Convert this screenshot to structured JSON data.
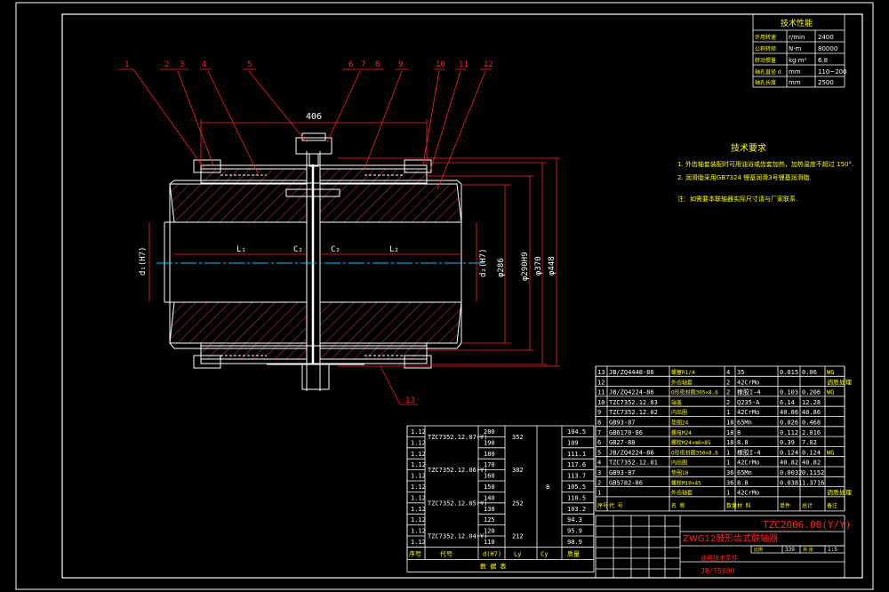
{
  "colors": {
    "background": "#000000",
    "frame": "#ffffff",
    "part": "#ffffff",
    "leader": "#ff2020",
    "centerline": "#00c8ff",
    "note": "#ffff00",
    "hatch": "#b5304a",
    "table": "#ffffff"
  },
  "balloons": [
    "1",
    "2",
    "3",
    "4",
    "5",
    "6",
    "7",
    "8",
    "9",
    "10",
    "11",
    "12",
    "13"
  ],
  "dimensions": {
    "overall_length": "406",
    "left_hub_len": "L₁",
    "left_gap": "C₂",
    "right_gap": "C₂",
    "right_hub_len": "L₂",
    "bore_left": "d₁(H7)",
    "bore_right": "d₂(H7)",
    "dia_286": "φ286",
    "dia_290": "φ290H9",
    "dia_370": "φ370",
    "dia_448": "φ448"
  },
  "tech_perf": {
    "title": "技术性能",
    "rows": [
      {
        "name": "许用转速",
        "unit": "r/min",
        "value": "2400"
      },
      {
        "name": "公称转矩",
        "unit": "N·m",
        "value": "80000"
      },
      {
        "name": "转动惯量",
        "unit": "kg·m²",
        "value": "6.8"
      },
      {
        "name": "轴孔直径 d",
        "unit": "mm",
        "value": "110~200"
      },
      {
        "name": "轴孔长度",
        "unit": "mm",
        "value": "2500"
      }
    ]
  },
  "tech_req": {
    "title": "技术要求",
    "items": [
      "1. 外齿轴套装配时可用油浴或齿套加热，加热温度不超过 150°.",
      "2. 润滑脂采用GB7324 锂基润滑3号锂基润滑脂.",
      "注：如需要本联轴器实际尺寸请与厂家联系."
    ]
  },
  "variants": {
    "rows": [
      {
        "ratio": "1.12",
        "code": "TZC7352.12.07(Y)",
        "d": "200",
        "ly": "352",
        "cy": "",
        "mass": "104.5"
      },
      {
        "ratio": "1.12",
        "code": "",
        "d": "190",
        "ly": "",
        "cy": "",
        "mass": "109"
      },
      {
        "ratio": "1.12",
        "code": "",
        "d": "180",
        "ly": "",
        "cy": "",
        "mass": "111.1"
      },
      {
        "ratio": "1.12",
        "code": "TZC7352.12.06(Y)",
        "d": "170",
        "ly": "302",
        "cy": "",
        "mass": "117.6"
      },
      {
        "ratio": "1.12",
        "code": "",
        "d": "160",
        "ly": "",
        "cy": "",
        "mass": "113.7"
      },
      {
        "ratio": "1.12",
        "code": "",
        "d": "150",
        "ly": "",
        "cy": "8",
        "mass": "105.5"
      },
      {
        "ratio": "1.12",
        "code": "TZC7352.12.05(Y)",
        "d": "140",
        "ly": "252",
        "cy": "",
        "mass": "110.5"
      },
      {
        "ratio": "1.12",
        "code": "",
        "d": "130",
        "ly": "",
        "cy": "",
        "mass": "103.2"
      },
      {
        "ratio": "1.12",
        "code": "",
        "d": "125",
        "ly": "",
        "cy": "",
        "mass": "94.3"
      },
      {
        "ratio": "1.12",
        "code": "TZC7352.12.04(Y)",
        "d": "120",
        "ly": "212",
        "cy": "",
        "mass": "95.9"
      },
      {
        "ratio": "1.12",
        "code": "",
        "d": "110",
        "ly": "",
        "cy": "",
        "mass": "98.9"
      }
    ],
    "headers": [
      "序号",
      "代号",
      "d(H7)",
      "Ly",
      "Cy",
      "质量"
    ],
    "footer": "数 据 表"
  },
  "bom": {
    "rows": [
      {
        "no": "13",
        "code": "JB/ZQ4448-86",
        "name": "螺塞R1/4",
        "qty": "4",
        "mat": "35",
        "w1": "0.015",
        "w2": "0.06",
        "note": "WG"
      },
      {
        "no": "12",
        "code": "",
        "name": "外齿轴套",
        "qty": "2",
        "mat": "42CrMo",
        "w1": "",
        "w2": "",
        "note": "调质处理"
      },
      {
        "no": "11",
        "code": "JB/ZQ4224-86",
        "name": "O形密封圈305×8.6",
        "qty": "2",
        "mat": "橡胶I-4",
        "w1": "0.103",
        "w2": "0.206",
        "note": "WG"
      },
      {
        "no": "10",
        "code": "TZC7352.12.03",
        "name": "端盖",
        "qty": "2",
        "mat": "Q235-A",
        "w1": "6.14",
        "w2": "12.28",
        "note": ""
      },
      {
        "no": "9",
        "code": "TZC7352.12.02",
        "name": "内齿圈",
        "qty": "1",
        "mat": "42CrMo",
        "w1": "40.86",
        "w2": "40.86",
        "note": ""
      },
      {
        "no": "8",
        "code": "GB93-87",
        "name": "垫圈24",
        "qty": "18",
        "mat": "65Mn",
        "w1": "0.026",
        "w2": "0.468",
        "note": ""
      },
      {
        "no": "7",
        "code": "GB6170-86",
        "name": "螺母M24",
        "qty": "18",
        "mat": "8",
        "w1": "0.112",
        "w2": "2.016",
        "note": ""
      },
      {
        "no": "6",
        "code": "GB27-88",
        "name": "螺栓M24×m6×85",
        "qty": "18",
        "mat": "8.8",
        "w1": "0.39",
        "w2": "7.02",
        "note": ""
      },
      {
        "no": "5",
        "code": "JB/ZQ4224-86",
        "name": "O形密封圈350×8.6",
        "qty": "1",
        "mat": "橡胶I-4",
        "w1": "0.124",
        "w2": "0.124",
        "note": "WG"
      },
      {
        "no": "4",
        "code": "TZC7352.12.01",
        "name": "内齿圈",
        "qty": "1",
        "mat": "42CrMo",
        "w1": "40.82",
        "w2": "40.82",
        "note": ""
      },
      {
        "no": "3",
        "code": "GB93-87",
        "name": "垫圈10",
        "qty": "36",
        "mat": "65Mn",
        "w1": "0.0032",
        "w2": "0.1152",
        "note": ""
      },
      {
        "no": "2",
        "code": "GB5782-86",
        "name": "螺栓M10×45",
        "qty": "36",
        "mat": "8.8",
        "w1": "0.0381",
        "w2": "1.3716",
        "note": ""
      },
      {
        "no": "1",
        "code": "",
        "name": "外齿轴套",
        "qty": "1",
        "mat": "42CrMo",
        "w1": "",
        "w2": "",
        "note": "调质处理"
      }
    ],
    "headers": [
      "序号",
      "代 号",
      "名 称",
      "数量",
      "材 料",
      "单件",
      "总计",
      "备注"
    ],
    "weight_header": "重量"
  },
  "title_block": {
    "drawing_no": "TZC2006.00(Y/Y)",
    "name": "ZWG12鼓形齿式联轴器",
    "scale_label": "比例",
    "weight": "339",
    "scale": "1:5",
    "sheet": "共 张",
    "standard_label": "通用技术条件",
    "standard": "JB/T5000"
  }
}
